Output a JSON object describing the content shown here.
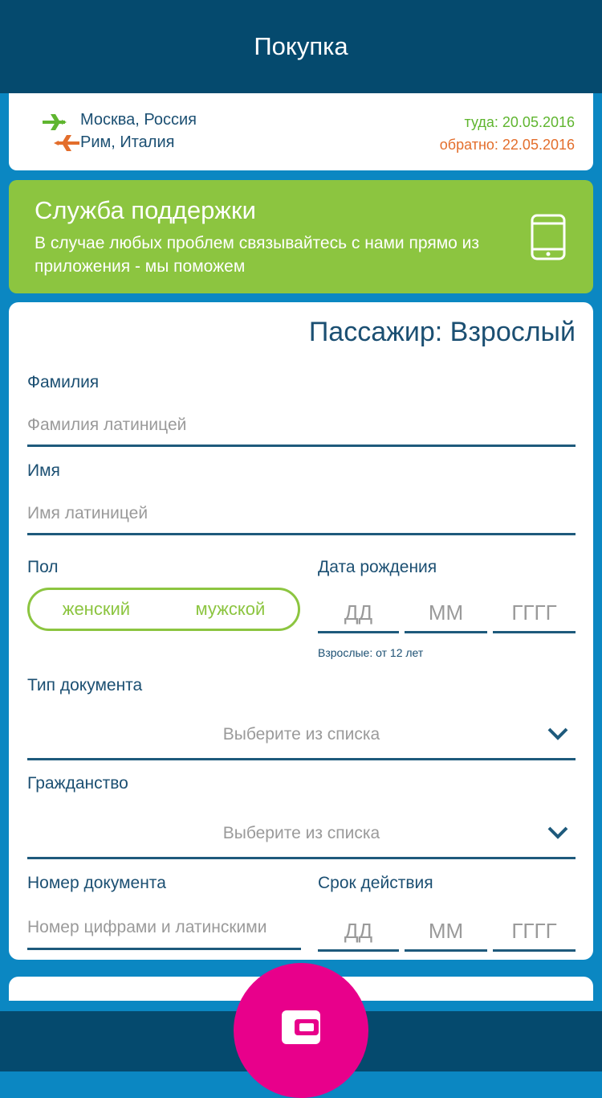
{
  "header": {
    "title": "Покупка"
  },
  "flight": {
    "from": "Москва, Россия",
    "to": "Рим, Италия",
    "date_there": "туда: 20.05.2016",
    "date_back": "обратно: 22.05.2016",
    "icon": "plane-icon"
  },
  "support": {
    "title": "Служба поддержки",
    "text": "В случае любых проблем связывайтесь с нами прямо из приложения - мы поможем",
    "icon": "tablet-icon"
  },
  "passenger_form": {
    "title": "Пассажир: Взрослый",
    "surname": {
      "label": "Фамилия",
      "placeholder": "Фамилия латиницей"
    },
    "name": {
      "label": "Имя",
      "placeholder": "Имя латиницей"
    },
    "gender": {
      "label": "Пол",
      "options": [
        "женский",
        "мужской"
      ]
    },
    "birth_date": {
      "label": "Дата рождения",
      "day_placeholder": "ДД",
      "month_placeholder": "ММ",
      "year_placeholder": "ГГГГ",
      "hint": "Взрослые: от 12 лет"
    },
    "document_type": {
      "label": "Тип документа",
      "value": "Выберите из списка"
    },
    "citizenship": {
      "label": "Гражданство",
      "value": "Выберите из списка"
    },
    "document_number": {
      "label": "Номер документа",
      "placeholder": "Номер цифрами и латинскими"
    },
    "expiry": {
      "label": "Срок действия",
      "day_placeholder": "ДД",
      "month_placeholder": "ММ",
      "year_placeholder": "ГГГГ"
    }
  },
  "fab": {
    "icon": "wallet-icon"
  },
  "colors": {
    "primary_dark": "#054a6e",
    "background": "#0b87c2",
    "accent_green": "#8cc540",
    "accent_orange": "#e36e2c",
    "fab": "#e8008b"
  }
}
